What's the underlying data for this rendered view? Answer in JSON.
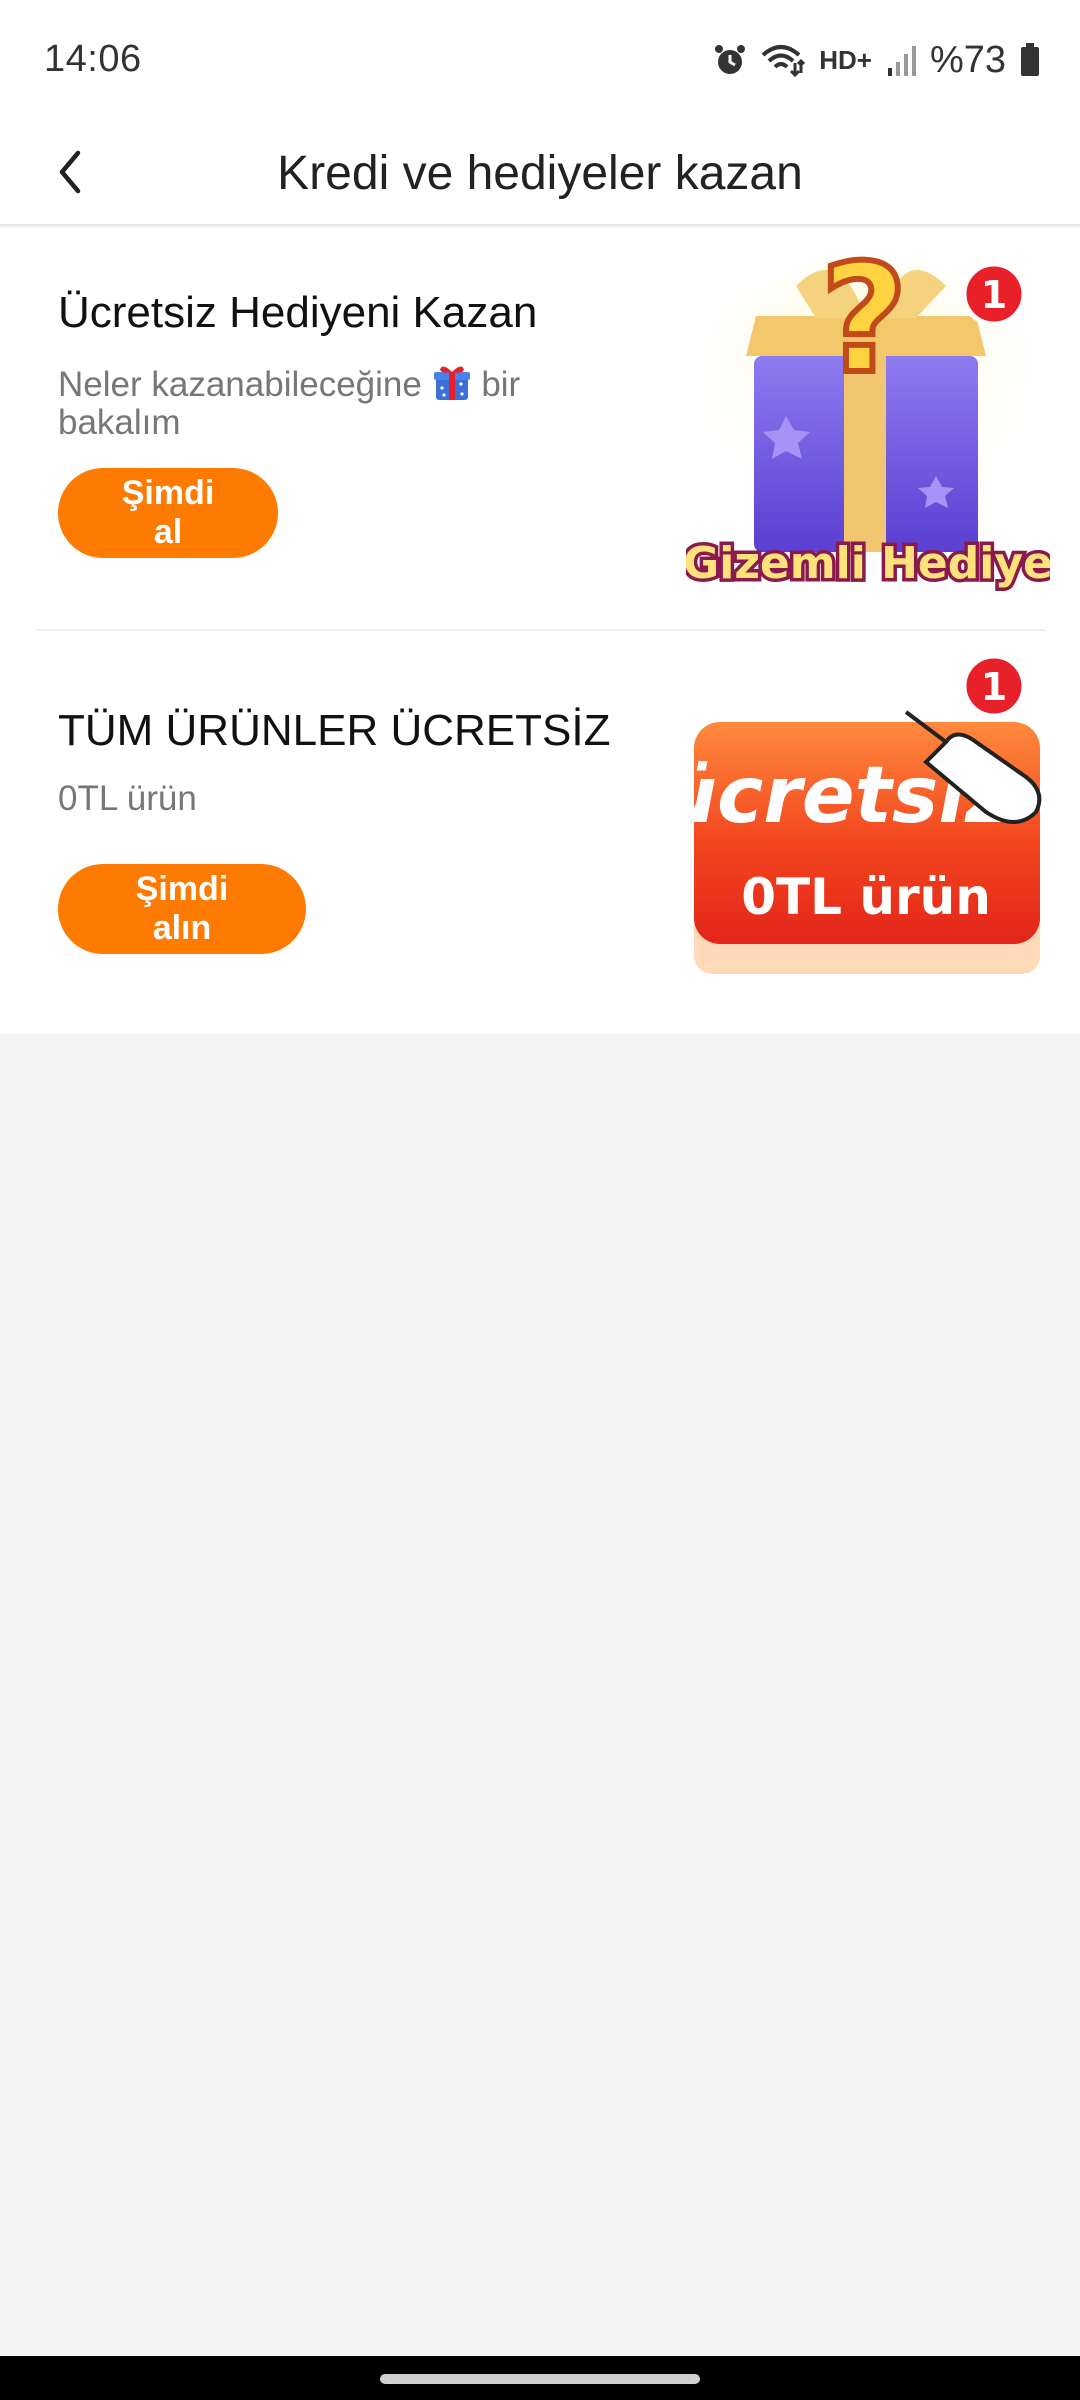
{
  "status_bar": {
    "time": "14:06",
    "network": "HD+",
    "battery": "%73",
    "icons": [
      "alarm-icon",
      "wifi-icon",
      "hd-plus-icon",
      "signal-icon",
      "battery-icon"
    ]
  },
  "header": {
    "title": "Kredi ve hediyeler kazan",
    "back_icon": "chevron-left-icon"
  },
  "cards": [
    {
      "title": "Ücretsiz Hediyeni Kazan",
      "subtitle_before": "Neler kazanabileceğine",
      "subtitle_after": "bir bakalım",
      "button": "Şimdi al",
      "image": {
        "caption": "Gizemli Hediye",
        "badge": "1",
        "symbol": "?"
      }
    },
    {
      "title": "TÜM ÜRÜNLER ÜCRETSİZ",
      "subtitle": "0TL ürün",
      "button": "Şimdi alın",
      "image": {
        "headline": "ücretsiz",
        "subline": "0TL ürün",
        "badge": "1"
      }
    }
  ],
  "colors": {
    "accent": "#ff7a00",
    "badge": "#e8202a",
    "background": "#f4f4f4"
  }
}
